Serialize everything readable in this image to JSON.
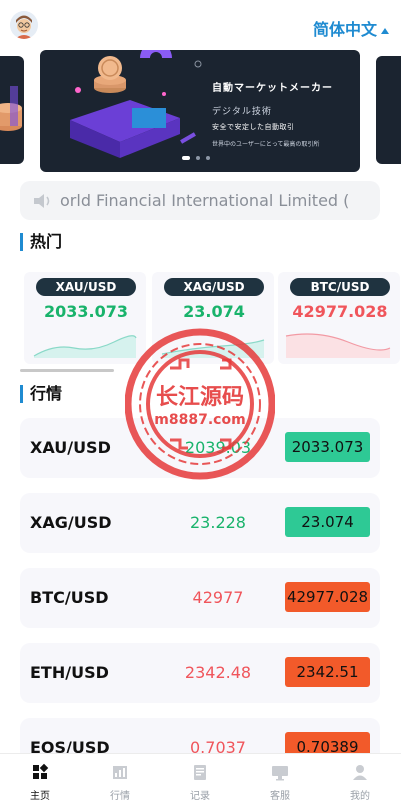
{
  "header": {
    "language_label": "简体中文"
  },
  "banner": {
    "title": "自動マーケットメーカー",
    "subtitle": "デジタル技術",
    "line3": "安全で安定した自動取引",
    "line4": "世界中のユーザーにとって最高の取引所"
  },
  "notice": {
    "text": "orld Financial International Limited ("
  },
  "sections": {
    "hot_title": "热门",
    "market_title": "行情"
  },
  "hot": [
    {
      "symbol": "XAU/USD",
      "price": "2033.073",
      "color": "#19b36b"
    },
    {
      "symbol": "XAG/USD",
      "price": "23.074",
      "color": "#19b36b"
    },
    {
      "symbol": "BTC/USD",
      "price": "42977.028",
      "color": "#f0555b"
    }
  ],
  "quotes": [
    {
      "symbol": "XAU/USD",
      "open": "2039.03",
      "current": "2033.073",
      "open_color": "#19b36b",
      "badge_color": "#2ec995"
    },
    {
      "symbol": "XAG/USD",
      "open": "23.228",
      "current": "23.074",
      "open_color": "#19b36b",
      "badge_color": "#2ec995"
    },
    {
      "symbol": "BTC/USD",
      "open": "42977",
      "current": "42977.028",
      "open_color": "#f0555b",
      "badge_color": "#f25a2a"
    },
    {
      "symbol": "ETH/USD",
      "open": "2342.48",
      "current": "2342.51",
      "open_color": "#f0555b",
      "badge_color": "#f25a2a"
    },
    {
      "symbol": "EOS/USD",
      "open": "0.7037",
      "current": "0.70389",
      "open_color": "#f0555b",
      "badge_color": "#f25a2a"
    }
  ],
  "watermark": {
    "line1": "长江源码",
    "line2": "m8887.com"
  },
  "tabs": [
    {
      "label": "主页",
      "icon": "home-grid-icon"
    },
    {
      "label": "行情",
      "icon": "market-chart-icon"
    },
    {
      "label": "记录",
      "icon": "record-doc-icon"
    },
    {
      "label": "客服",
      "icon": "service-monitor-icon"
    },
    {
      "label": "我的",
      "icon": "user-profile-icon"
    }
  ],
  "colors": {
    "accent": "#1f8bd1",
    "up": "#19b36b",
    "down": "#f0555b"
  }
}
